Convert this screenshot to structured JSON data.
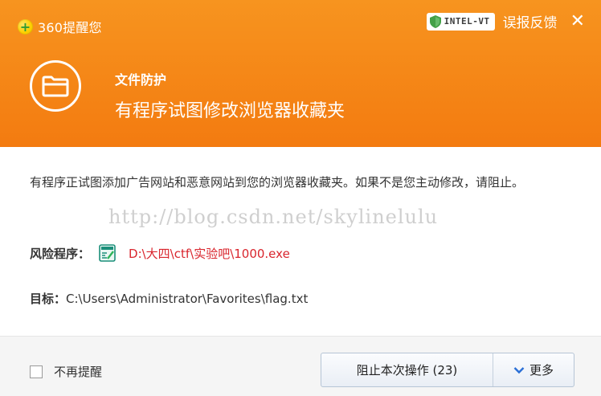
{
  "header": {
    "app_name": "360提醒您",
    "badge_text": "INTEL-VT",
    "feedback_label": "误报反馈",
    "close_glyph": "✕",
    "subtitle": "文件防护",
    "title": "有程序试图修改浏览器收藏夹"
  },
  "body": {
    "message": "有程序正试图添加广告网站和恶意网站到您的浏览器收藏夹。如果不是您主动修改，请阻止。",
    "watermark": "http://blog.csdn.net/skylinelulu",
    "risk_label": "风险程序：",
    "risk_path": "D:\\大四\\ctf\\实验吧\\1000.exe",
    "target_label": "目标：",
    "target_path": "C:\\Users\\Administrator\\Favorites\\flag.txt"
  },
  "footer": {
    "checkbox_label": "不再提醒",
    "checkbox_checked": false,
    "block_button": "阻止本次操作 (23)",
    "more_button": "更多"
  },
  "colors": {
    "header_orange": "#f37b10",
    "risk_path_red": "#d9252d",
    "more_chevron_blue": "#2a6fd6"
  },
  "icons": {
    "brand": "360-logo-icon",
    "badge": "shield-icon",
    "hero": "folder-icon",
    "program": "program-file-icon",
    "more": "chevron-down-icon"
  }
}
